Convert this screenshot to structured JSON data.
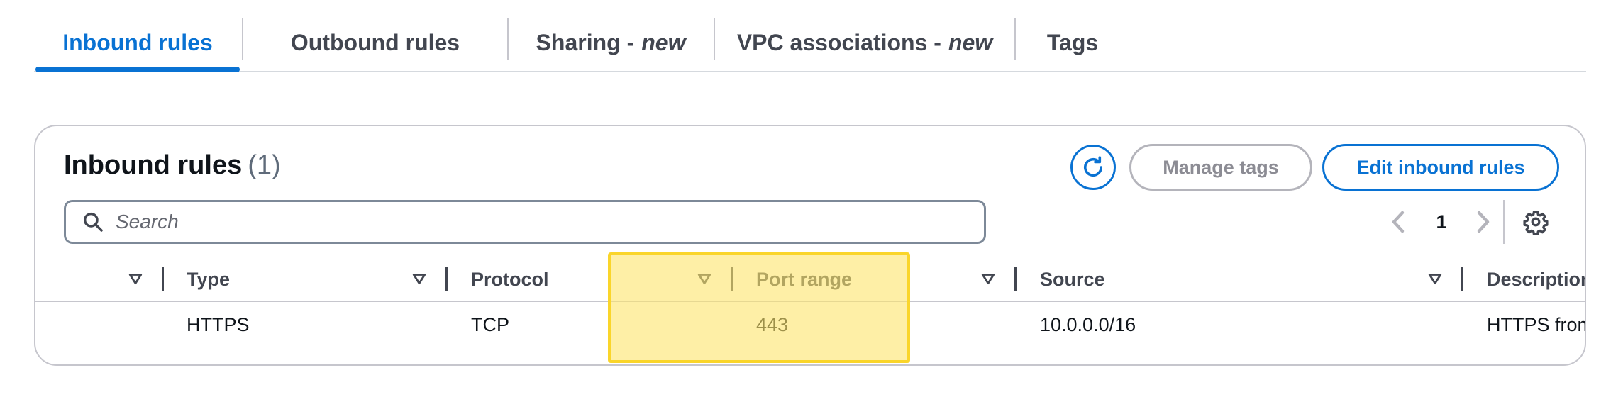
{
  "tabs": [
    {
      "label": "Inbound rules",
      "suffix": "",
      "active": true
    },
    {
      "label": "Outbound rules",
      "suffix": "",
      "active": false
    },
    {
      "label": "Sharing -",
      "suffix": "new",
      "active": false
    },
    {
      "label": "VPC associations -",
      "suffix": "new",
      "active": false
    },
    {
      "label": "Tags",
      "suffix": "",
      "active": false
    }
  ],
  "panel": {
    "title": "Inbound rules",
    "count": "(1)",
    "manage_tags_label": "Manage tags",
    "edit_rules_label": "Edit inbound rules",
    "refresh_icon": "refresh-icon"
  },
  "search": {
    "placeholder": "Search",
    "value": "",
    "icon": "search-icon"
  },
  "pagination": {
    "current_page": "1",
    "prev_icon": "chevron-left-icon",
    "next_icon": "chevron-right-icon",
    "settings_icon": "gear-icon"
  },
  "table": {
    "columns": [
      "Type",
      "Protocol",
      "Port range",
      "Source",
      "Description"
    ],
    "rows": [
      {
        "type": "HTTPS",
        "protocol": "TCP",
        "port_range": "443",
        "source": "10.0.0.0/16",
        "description": "HTTPS from"
      }
    ]
  },
  "colors": {
    "accent": "#0972d3",
    "highlight_fill": "#fde46a",
    "highlight_border": "#fad52a",
    "text_header": "#424650",
    "border": "#c6c6cd"
  }
}
